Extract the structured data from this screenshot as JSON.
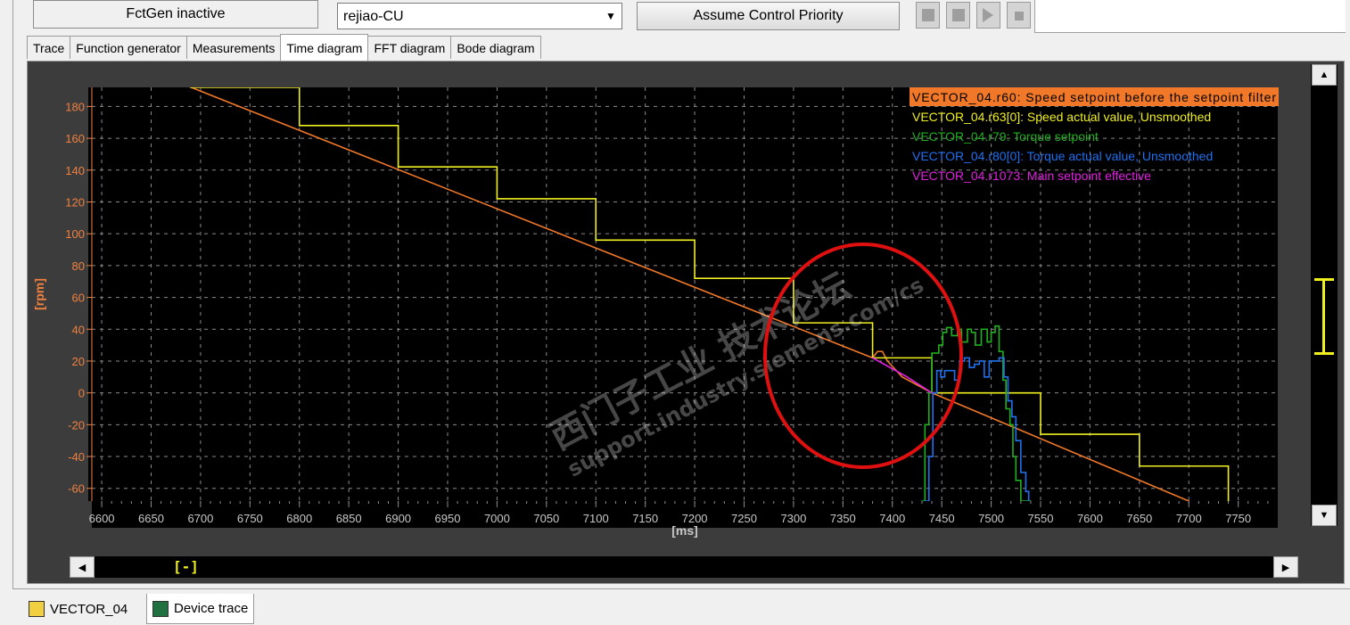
{
  "toolbar": {
    "status_label": "FctGen  inactive",
    "device_value": "rejiao-CU",
    "assume_label": "Assume Control Priority"
  },
  "tabs": [
    {
      "label": "Trace"
    },
    {
      "label": "Function generator"
    },
    {
      "label": "Measurements"
    },
    {
      "label": "Time diagram",
      "active": true
    },
    {
      "label": "FFT diagram"
    },
    {
      "label": "Bode diagram"
    }
  ],
  "bottom_tabs": [
    {
      "label": "VECTOR_04"
    },
    {
      "label": "Device trace"
    }
  ],
  "scroll": {
    "hthumb": "[-]"
  },
  "watermark": {
    "line1": "西门子工业 技术论坛",
    "line2": "support.industry.siemens.com/cs"
  },
  "colors": {
    "background": "#000000",
    "grid": "#8a8a8a",
    "axis_text": "#f08040",
    "highlight_circle": "#e01010"
  },
  "chart_data": {
    "type": "line",
    "xlabel": "[ms]",
    "ylabel": "[rpm]",
    "xlim": [
      6590,
      7790
    ],
    "ylim": [
      -68,
      192
    ],
    "x_ticks": [
      6600,
      6650,
      6700,
      6750,
      6800,
      6850,
      6900,
      6950,
      7000,
      7050,
      7100,
      7150,
      7200,
      7250,
      7300,
      7350,
      7400,
      7450,
      7500,
      7550,
      7600,
      7650,
      7700,
      7750
    ],
    "y_ticks": [
      180,
      160,
      140,
      120,
      100,
      80,
      60,
      40,
      20,
      0,
      -20,
      -40,
      -60
    ],
    "grid": true,
    "legend_position": "top-right",
    "series": [
      {
        "name": "VECTOR_04.r60: Speed setpoint before the setpoint filter",
        "color": "#f07828",
        "x": [
          6650,
          7380,
          7385,
          7390,
          7395,
          7410,
          7440,
          7700
        ],
        "y": [
          202,
          22,
          26,
          26,
          20,
          10,
          0,
          -68
        ]
      },
      {
        "name": "VECTOR_04.r63[0]: Speed actual value, Unsmoothed",
        "color": "#f0f020",
        "x": [
          6690,
          6800,
          6900,
          7000,
          7100,
          7200,
          7300,
          7380,
          7440,
          7550,
          7650,
          7740
        ],
        "y": [
          192,
          168,
          142,
          122,
          96,
          72,
          44,
          22,
          0,
          -26,
          -46,
          -68
        ]
      },
      {
        "name": "VECTOR_04.r79: Torque setpoint",
        "color": "#20b020",
        "x": [
          7430,
          7433,
          7437,
          7440,
          7447,
          7451,
          7455,
          7460,
          7466,
          7470,
          7476,
          7480,
          7484,
          7490,
          7496,
          7500,
          7504,
          7508,
          7512,
          7515,
          7519,
          7522,
          7525,
          7530,
          7535,
          7540
        ],
        "y": [
          -68,
          -20,
          0,
          25,
          30,
          38,
          41,
          36,
          40,
          32,
          40,
          38,
          30,
          40,
          32,
          38,
          42,
          26,
          8,
          -10,
          -20,
          -40,
          -55,
          -68,
          -68,
          -68
        ]
      },
      {
        "name": "VECTOR_04.r80[0]: Torque actual value, Unsmoothed",
        "color": "#2070f0",
        "x": [
          7433,
          7437,
          7441,
          7445,
          7449,
          7453,
          7458,
          7463,
          7468,
          7473,
          7478,
          7483,
          7488,
          7493,
          7498,
          7503,
          7508,
          7513,
          7517,
          7521,
          7525,
          7530,
          7535,
          7538
        ],
        "y": [
          -68,
          -40,
          0,
          14,
          10,
          14,
          14,
          8,
          20,
          22,
          16,
          18,
          20,
          10,
          20,
          20,
          22,
          10,
          -5,
          -15,
          -30,
          -50,
          -62,
          -68
        ]
      },
      {
        "name": "VECTOR_04.r1073: Main setpoint effective",
        "color": "#e020e0",
        "x": [
          7380,
          7415,
          7440
        ],
        "y": [
          22,
          10,
          0
        ]
      }
    ]
  }
}
